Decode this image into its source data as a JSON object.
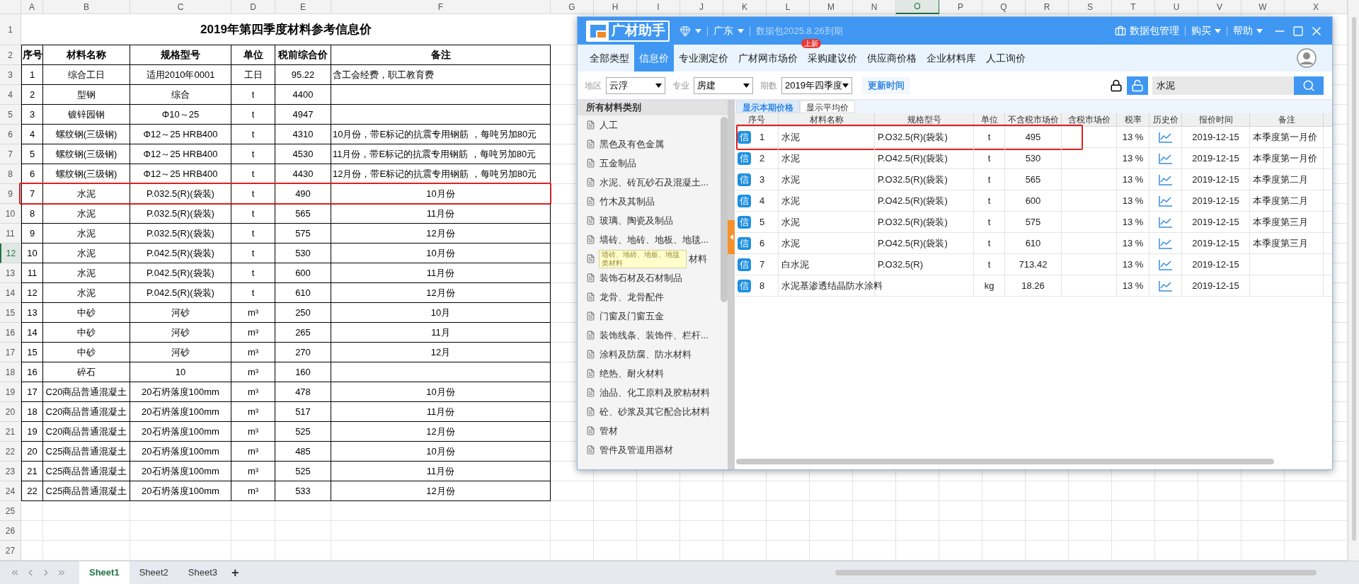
{
  "spreadsheet": {
    "column_headers": [
      {
        "label": "A",
        "selected": false
      },
      {
        "label": "B",
        "selected": false
      },
      {
        "label": "C",
        "selected": false
      },
      {
        "label": "D",
        "selected": false
      },
      {
        "label": "E",
        "selected": false
      },
      {
        "label": "F",
        "selected": false
      },
      {
        "label": "G",
        "selected": false
      },
      {
        "label": "H",
        "selected": false
      },
      {
        "label": "I",
        "selected": false
      },
      {
        "label": "J",
        "selected": false
      },
      {
        "label": "K",
        "selected": false
      },
      {
        "label": "L",
        "selected": false
      },
      {
        "label": "M",
        "selected": false
      },
      {
        "label": "N",
        "selected": false
      },
      {
        "label": "O",
        "selected": true
      },
      {
        "label": "P",
        "selected": false
      },
      {
        "label": "Q",
        "selected": false
      },
      {
        "label": "R",
        "selected": false
      },
      {
        "label": "S",
        "selected": false
      },
      {
        "label": "T",
        "selected": false
      },
      {
        "label": "U",
        "selected": false
      },
      {
        "label": "V",
        "selected": false
      },
      {
        "label": "W",
        "selected": false
      },
      {
        "label": "X",
        "selected": false
      }
    ],
    "row_headers": [
      {
        "label": "1",
        "selected": false
      },
      {
        "label": "2",
        "selected": false
      },
      {
        "label": "3",
        "selected": false
      },
      {
        "label": "4",
        "selected": false
      },
      {
        "label": "5",
        "selected": false
      },
      {
        "label": "6",
        "selected": false
      },
      {
        "label": "7",
        "selected": false
      },
      {
        "label": "8",
        "selected": false
      },
      {
        "label": "9",
        "selected": false
      },
      {
        "label": "10",
        "selected": false
      },
      {
        "label": "11",
        "selected": false
      },
      {
        "label": "12",
        "selected": true
      },
      {
        "label": "13",
        "selected": false
      },
      {
        "label": "14",
        "selected": false
      },
      {
        "label": "15",
        "selected": false
      },
      {
        "label": "16",
        "selected": false
      },
      {
        "label": "17",
        "selected": false
      },
      {
        "label": "18",
        "selected": false
      },
      {
        "label": "19",
        "selected": false
      },
      {
        "label": "20",
        "selected": false
      },
      {
        "label": "21",
        "selected": false
      },
      {
        "label": "22",
        "selected": false
      },
      {
        "label": "23",
        "selected": false
      },
      {
        "label": "24",
        "selected": false
      },
      {
        "label": "25",
        "selected": false
      },
      {
        "label": "26",
        "selected": false
      },
      {
        "label": "27",
        "selected": false
      }
    ],
    "title": "2019年第四季度材料参考信息价",
    "table_header": [
      "序号",
      "材料名称",
      "规格型号",
      "单位",
      "税前综合价",
      "备注"
    ],
    "rows": [
      {
        "no": "1",
        "name": "综合工日",
        "spec": "适用2010年0001",
        "unit": "工日",
        "price": "95.22",
        "note": "含工会经费，职工教育费",
        "highlighted": false
      },
      {
        "no": "2",
        "name": "型钢",
        "spec": "综合",
        "unit": "t",
        "price": "4400",
        "highlighted": false
      },
      {
        "no": "3",
        "name": "镀锌园钢",
        "spec": "Φ10～25",
        "unit": "t",
        "price": "4947",
        "highlighted": false
      },
      {
        "no": "4",
        "name": "螺纹钢(三级钢)",
        "spec": "Φ12～25 HRB400",
        "unit": "t",
        "price": "4310",
        "note": "10月份，带E标记的抗震专用钢筋 ，每吨另加80元",
        "highlighted": false
      },
      {
        "no": "5",
        "name": "螺纹钢(三级钢)",
        "spec": "Φ12～25 HRB400",
        "unit": "t",
        "price": "4530",
        "note": "11月份，带E标记的抗震专用钢筋 ，每吨另加80元",
        "highlighted": false
      },
      {
        "no": "6",
        "name": "螺纹钢(三级钢)",
        "spec": "Φ12～25 HRB400",
        "unit": "t",
        "price": "4430",
        "note": "12月份，带E标记的抗震专用钢筋 ，每吨另加80元",
        "highlighted": false
      },
      {
        "no": "7",
        "name": "水泥",
        "spec": "P.032.5(R)(袋装)",
        "unit": "t",
        "price": "490",
        "note": "10月份",
        "highlighted": true
      },
      {
        "no": "8",
        "name": "水泥",
        "spec": "P.032.5(R)(袋装)",
        "unit": "t",
        "price": "565",
        "note": "11月份",
        "highlighted": false
      },
      {
        "no": "9",
        "name": "水泥",
        "spec": "P.032.5(R)(袋装)",
        "unit": "t",
        "price": "575",
        "note": "12月份",
        "highlighted": false
      },
      {
        "no": "10",
        "name": "水泥",
        "spec": "P.042.5(R)(袋装)",
        "unit": "t",
        "price": "530",
        "note": "10月份",
        "highlighted": false
      },
      {
        "no": "11",
        "name": "水泥",
        "spec": "P.042.5(R)(袋装)",
        "unit": "t",
        "price": "600",
        "note": "11月份",
        "highlighted": false
      },
      {
        "no": "12",
        "name": "水泥",
        "spec": "P.042.5(R)(袋装)",
        "unit": "t",
        "price": "610",
        "note": "12月份",
        "highlighted": false
      },
      {
        "no": "13",
        "name": "中砂",
        "spec": "河砂",
        "unit": "m³",
        "price": "250",
        "note": "10月",
        "highlighted": false
      },
      {
        "no": "14",
        "name": "中砂",
        "spec": "河砂",
        "unit": "m³",
        "price": "265",
        "note": "11月",
        "highlighted": false
      },
      {
        "no": "15",
        "name": "中砂",
        "spec": "河砂",
        "unit": "m³",
        "price": "270",
        "note": "12月",
        "highlighted": false
      },
      {
        "no": "16",
        "name": "碎石",
        "spec": "10",
        "unit": "m³",
        "price": "160",
        "highlighted": false
      },
      {
        "no": "17",
        "name": "C20商品普通混凝土",
        "spec": "20石坍落度100mm",
        "unit": "m³",
        "price": "478",
        "note": "10月份",
        "highlighted": false
      },
      {
        "no": "18",
        "name": "C20商品普通混凝土",
        "spec": "20石坍落度100mm",
        "unit": "m³",
        "price": "517",
        "note": "11月份",
        "highlighted": false
      },
      {
        "no": "19",
        "name": "C20商品普通混凝土",
        "spec": "20石坍落度100mm",
        "unit": "m³",
        "price": "525",
        "note": "12月份",
        "highlighted": false
      },
      {
        "no": "20",
        "name": "C25商品普通混凝土",
        "spec": "20石坍落度100mm",
        "unit": "m³",
        "price": "485",
        "note": "10月份",
        "highlighted": false
      },
      {
        "no": "21",
        "name": "C25商品普通混凝土",
        "spec": "20石坍落度100mm",
        "unit": "m³",
        "price": "525",
        "note": "11月份",
        "highlighted": false
      },
      {
        "no": "22",
        "name": "C25商品普通混凝土",
        "spec": "20石坍落度100mm",
        "unit": "m³",
        "price": "533",
        "note": "12月份",
        "highlighted": false
      }
    ]
  },
  "sheet_tabs": [
    {
      "label": "Sheet1",
      "selected": true
    },
    {
      "label": "Sheet2",
      "selected": false
    },
    {
      "label": "Sheet3",
      "selected": false
    }
  ],
  "add_sheet": "+",
  "app": {
    "brand": "广材助手",
    "region": "广东",
    "package_notice": "数据包2025.8.26到期",
    "title_actions": [
      {
        "label": "数据包管理",
        "kind": "icon"
      },
      {
        "label": "购买",
        "kind": "menu"
      },
      {
        "label": "帮助",
        "kind": "menu"
      }
    ],
    "tabs": [
      {
        "label": "全部类型",
        "selected": false
      },
      {
        "label": "信息价",
        "selected": true
      },
      {
        "label": "专业测定价",
        "selected": false
      },
      {
        "label": "广材网市场价",
        "selected": false
      },
      {
        "label": "采购建议价",
        "selected": false,
        "badge": "上新"
      },
      {
        "label": "供应商价格",
        "selected": false
      },
      {
        "label": "企业材料库",
        "selected": false
      },
      {
        "label": "人工询价",
        "selected": false
      }
    ],
    "filters": [
      {
        "label": "地区",
        "value": "云浮"
      },
      {
        "label": "专业",
        "value": "房建"
      },
      {
        "label": "期数",
        "value": "2019年四季度"
      }
    ],
    "update_button": "更新时间",
    "search": {
      "value": "水泥"
    },
    "category_header": "所有材料类别",
    "categories": [
      {
        "label": "人工"
      },
      {
        "label": "黑色及有色金属"
      },
      {
        "label": "五金制品"
      },
      {
        "label": "水泥、砖瓦砂石及混凝土..."
      },
      {
        "label": "竹木及其制品"
      },
      {
        "label": "玻璃、陶瓷及制品"
      },
      {
        "label": "墙砖、地砖、地板、地毯..."
      },
      {
        "label": "材料",
        "tooltip": "墙砖、地砖、地板、地毯类材料"
      },
      {
        "label": "装饰石材及石材制品"
      },
      {
        "label": "龙骨、龙骨配件"
      },
      {
        "label": "门窗及门窗五金"
      },
      {
        "label": "装饰线条、装饰件、栏杆..."
      },
      {
        "label": "涂料及防腐、防水材料"
      },
      {
        "label": "绝热、耐火材料"
      },
      {
        "label": "油品、化工原料及胶粘材料"
      },
      {
        "label": "砼、砂浆及其它配合比材料"
      },
      {
        "label": "管材"
      },
      {
        "label": "管件及管道用器材"
      }
    ],
    "view_tabs": [
      {
        "label": "显示本期价格",
        "selected": true
      },
      {
        "label": "显示平均价",
        "selected": false
      }
    ],
    "table": {
      "columns": [
        "序号",
        "材料名称",
        "规格型号",
        "单位",
        "不含税市场价",
        "含税市场价",
        "税率",
        "历史价",
        "报价时间",
        "备注"
      ],
      "rows": [
        {
          "badge": "信",
          "no": "1",
          "name": "水泥",
          "spec": "P.O32.5(R)(袋装)",
          "unit": "t",
          "price": "495",
          "tax": "13 %",
          "date": "2019-12-15",
          "note": "本季度第一月价",
          "highlighted": true
        },
        {
          "badge": "信",
          "no": "2",
          "name": "水泥",
          "spec": "P.O42.5(R)(袋装)",
          "unit": "t",
          "price": "530",
          "tax": "13 %",
          "date": "2019-12-15",
          "note": "本季度第一月价",
          "highlighted": false
        },
        {
          "badge": "信",
          "no": "3",
          "name": "水泥",
          "spec": "P.O32.5(R)(袋装)",
          "unit": "t",
          "price": "565",
          "tax": "13 %",
          "date": "2019-12-15",
          "note": "本季度第二月",
          "highlighted": false
        },
        {
          "badge": "信",
          "no": "4",
          "name": "水泥",
          "spec": "P.O42.5(R)(袋装)",
          "unit": "t",
          "price": "600",
          "tax": "13 %",
          "date": "2019-12-15",
          "note": "本季度第二月",
          "highlighted": false
        },
        {
          "badge": "信",
          "no": "5",
          "name": "水泥",
          "spec": "P.O32.5(R)(袋装)",
          "unit": "t",
          "price": "575",
          "tax": "13 %",
          "date": "2019-12-15",
          "note": "本季度第三月",
          "highlighted": false
        },
        {
          "badge": "信",
          "no": "6",
          "name": "水泥",
          "spec": "P.O42.5(R)(袋装)",
          "unit": "t",
          "price": "610",
          "tax": "13 %",
          "date": "2019-12-15",
          "note": "本季度第三月",
          "highlighted": false
        },
        {
          "badge": "信",
          "no": "7",
          "name": "白水泥",
          "spec": "P.O32.5(R)",
          "unit": "t",
          "price": "713.42",
          "tax": "13 %",
          "date": "2019-12-15",
          "highlighted": false
        },
        {
          "badge": "信",
          "no": "8",
          "name": "水泥基渗透结晶防水涂料",
          "unit": "kg",
          "price": "18.26",
          "tax": "13 %",
          "date": "2019-12-15",
          "highlighted": false
        }
      ]
    }
  }
}
